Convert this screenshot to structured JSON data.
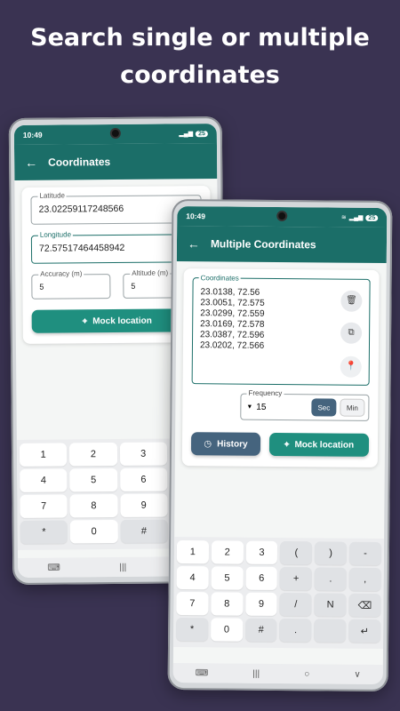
{
  "headline": {
    "line1": "Search single or multiple",
    "line2": "coordinates"
  },
  "phone1": {
    "status": {
      "time": "10:49",
      "battery": "25"
    },
    "appbar": {
      "title": "Coordinates"
    },
    "fields": {
      "latitude": {
        "label": "Latitude",
        "value": "23.02259117248566"
      },
      "longitude": {
        "label": "Longitude",
        "value": "72.57517464458942"
      },
      "accuracy": {
        "label": "Accuracy (m)",
        "value": "5"
      },
      "altitude": {
        "label": "Altitude (m)",
        "value": "5"
      }
    },
    "mock_button": "Mock location",
    "keypad": [
      [
        "1",
        "2",
        "3",
        "("
      ],
      [
        "4",
        "5",
        "6",
        "+"
      ],
      [
        "7",
        "8",
        "9",
        "/"
      ],
      [
        "*",
        "0",
        "#",
        "."
      ]
    ]
  },
  "phone2": {
    "status": {
      "time": "10:49",
      "battery": "25"
    },
    "appbar": {
      "title": "Multiple Coordinates"
    },
    "coordinates": {
      "label": "Coordinates",
      "lines": [
        "23.0138, 72.56",
        "23.0051, 72.575",
        "23.0299, 72.559",
        "23.0169, 72.578",
        "23.0387, 72.596",
        "23.0202, 72.566"
      ]
    },
    "frequency": {
      "label": "Frequency",
      "value": "15",
      "unit_sec": "Sec",
      "unit_min": "Min",
      "selected": "Sec"
    },
    "history_button": "History",
    "mock_button": "Mock location",
    "keypad": [
      [
        "1",
        "2",
        "3",
        "(",
        ")",
        "-"
      ],
      [
        "4",
        "5",
        "6",
        "+",
        ".",
        ","
      ],
      [
        "7",
        "8",
        "9",
        "/",
        "N",
        "⌫"
      ],
      [
        "*",
        "0",
        "#",
        ".",
        "",
        "↵"
      ]
    ]
  },
  "colors": {
    "background": "#3a3352",
    "teal": "#1b6e68",
    "button_teal": "#1f8f7f",
    "slate": "#45647e"
  }
}
